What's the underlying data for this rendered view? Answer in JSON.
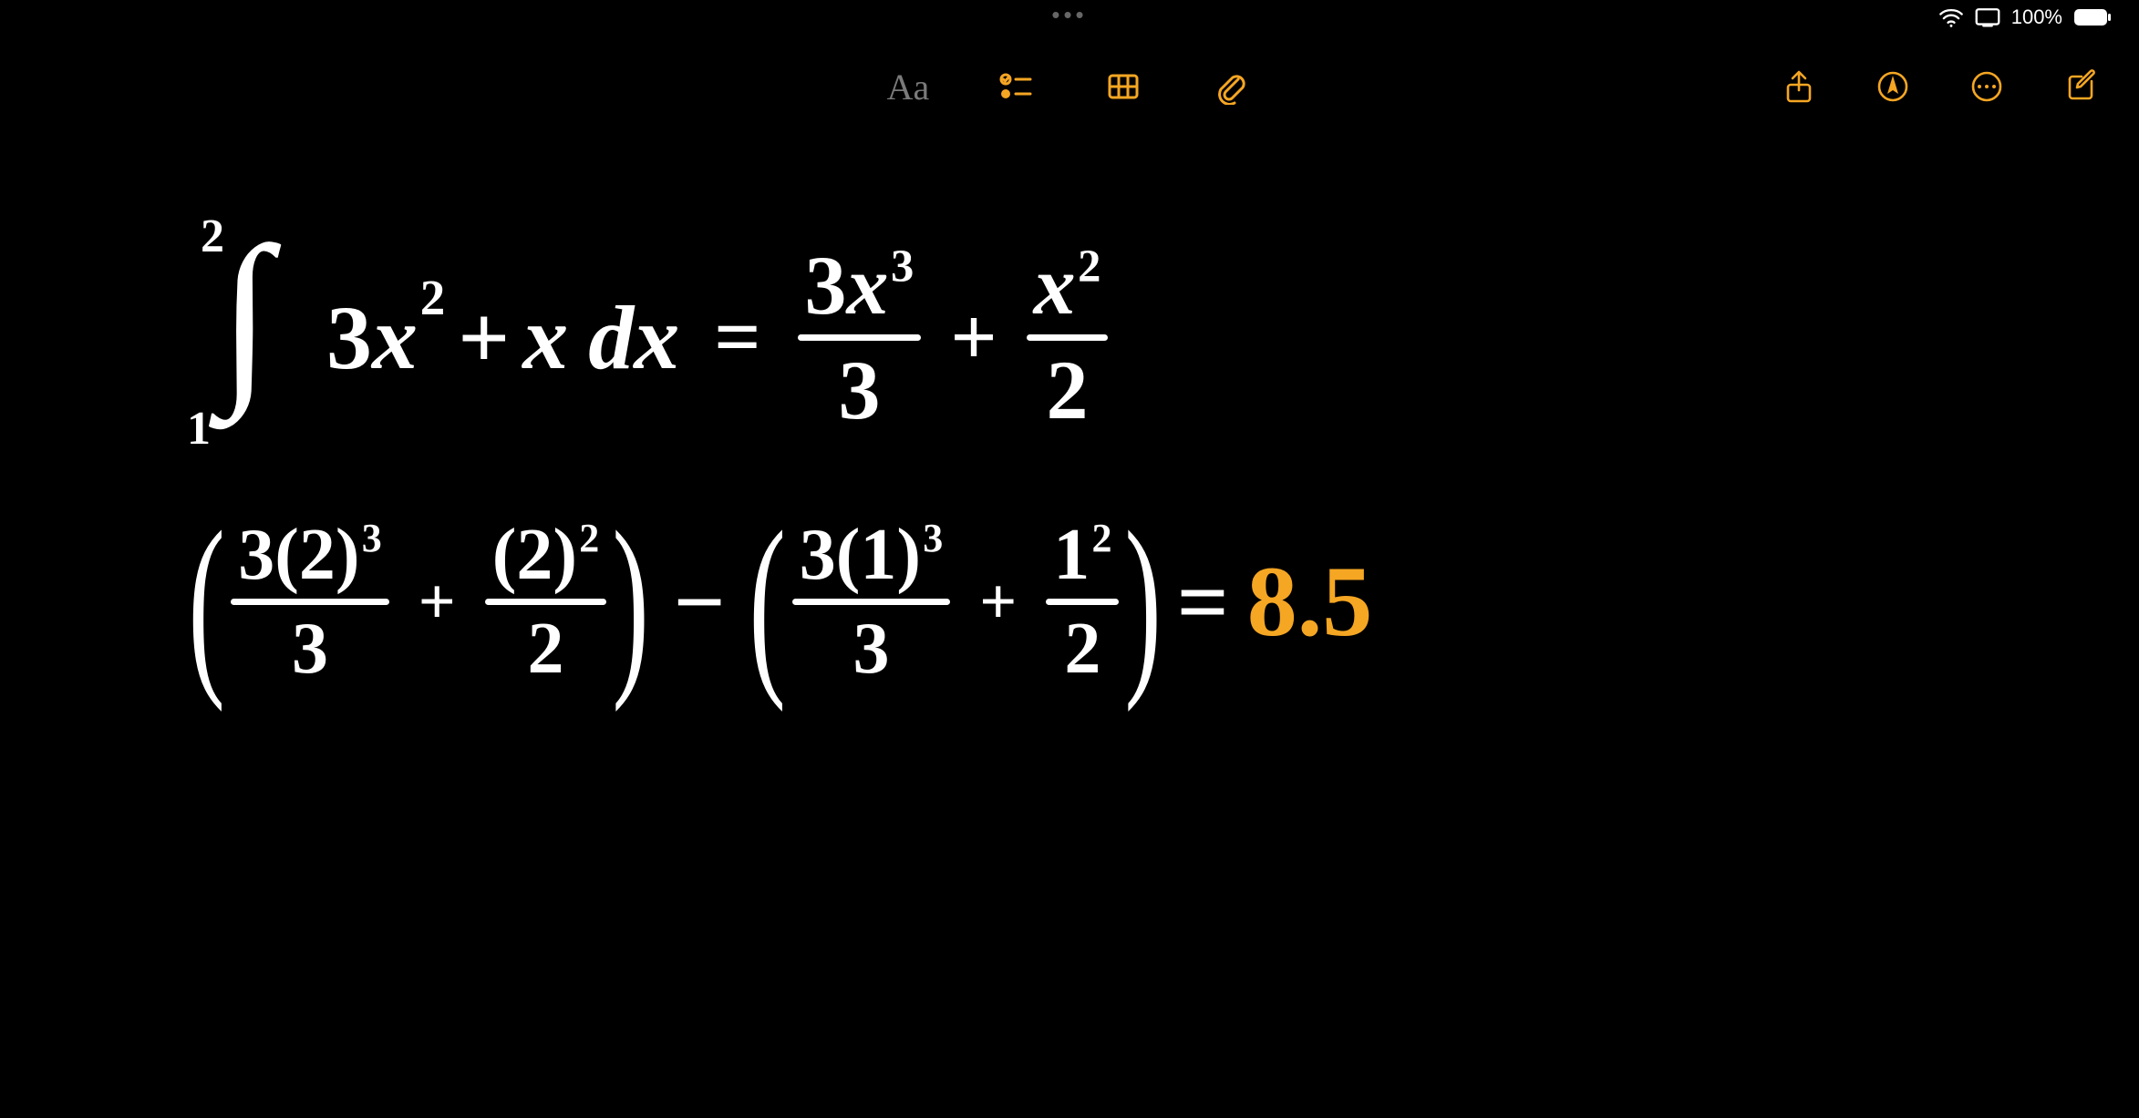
{
  "status": {
    "battery_percent": "100%"
  },
  "toolbar": {
    "text_format_label": "Aa"
  },
  "equation": {
    "line1": {
      "integral_upper": "2",
      "integral_lower": "1",
      "integrand_a_coef": "3",
      "integrand_a_var": "x",
      "integrand_a_pow": "2",
      "integrand_plus": "+",
      "integrand_b_var": "x",
      "dx": "dx",
      "eq": "=",
      "rhs_f1_num_coef": "3",
      "rhs_f1_num_var": "x",
      "rhs_f1_num_pow": "3",
      "rhs_f1_den": "3",
      "rhs_plus": "+",
      "rhs_f2_num_var": "x",
      "rhs_f2_num_pow": "2",
      "rhs_f2_den": "2"
    },
    "line2": {
      "g1_f1_num": "3(2)",
      "g1_f1_num_pow": "3",
      "g1_f1_den": "3",
      "g1_plus": "+",
      "g1_f2_num": "(2)",
      "g1_f2_num_pow": "2",
      "g1_f2_den": "2",
      "minus": "−",
      "g2_f1_num": "3(1)",
      "g2_f1_num_pow": "3",
      "g2_f1_den": "3",
      "g2_plus": "+",
      "g2_f2_num": "1",
      "g2_f2_num_pow": "2",
      "g2_f2_den": "2",
      "result_eq": "=",
      "result": "8.5"
    }
  }
}
